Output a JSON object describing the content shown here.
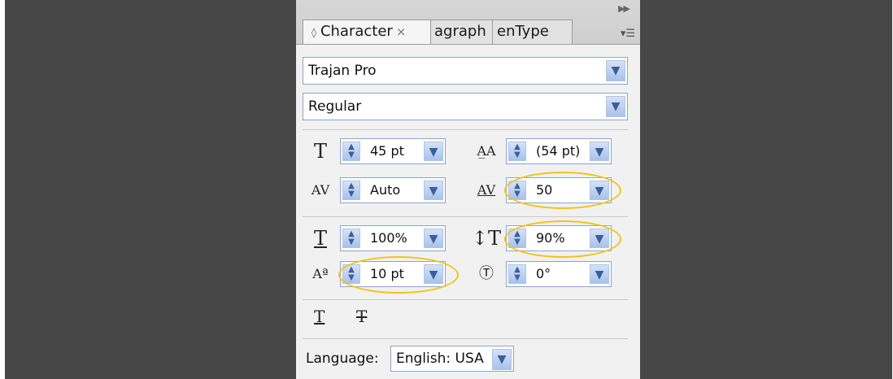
{
  "panel": {
    "collapse_icon": "double-chevron-right",
    "tabs": [
      {
        "label": "Character",
        "active": true
      },
      {
        "label": "agraph",
        "active": false
      },
      {
        "label": "enType",
        "active": false
      }
    ],
    "tab_close": "×",
    "tab_arrows": "◊"
  },
  "font": {
    "family": "Trajan Pro",
    "style": "Regular"
  },
  "controls": {
    "font_size": "45 pt",
    "leading": "(54 pt)",
    "kerning": "Auto",
    "tracking": "50",
    "horizontal_scale": "100%",
    "vertical_scale": "90%",
    "baseline_shift": "10 pt",
    "rotation": "0°"
  },
  "language": {
    "label": "Language:",
    "value": "English: USA"
  },
  "colors": {
    "highlight_ring": "#f3c21a",
    "dropdown_blue": "#a9c2ea",
    "background_dark": "#474747"
  }
}
